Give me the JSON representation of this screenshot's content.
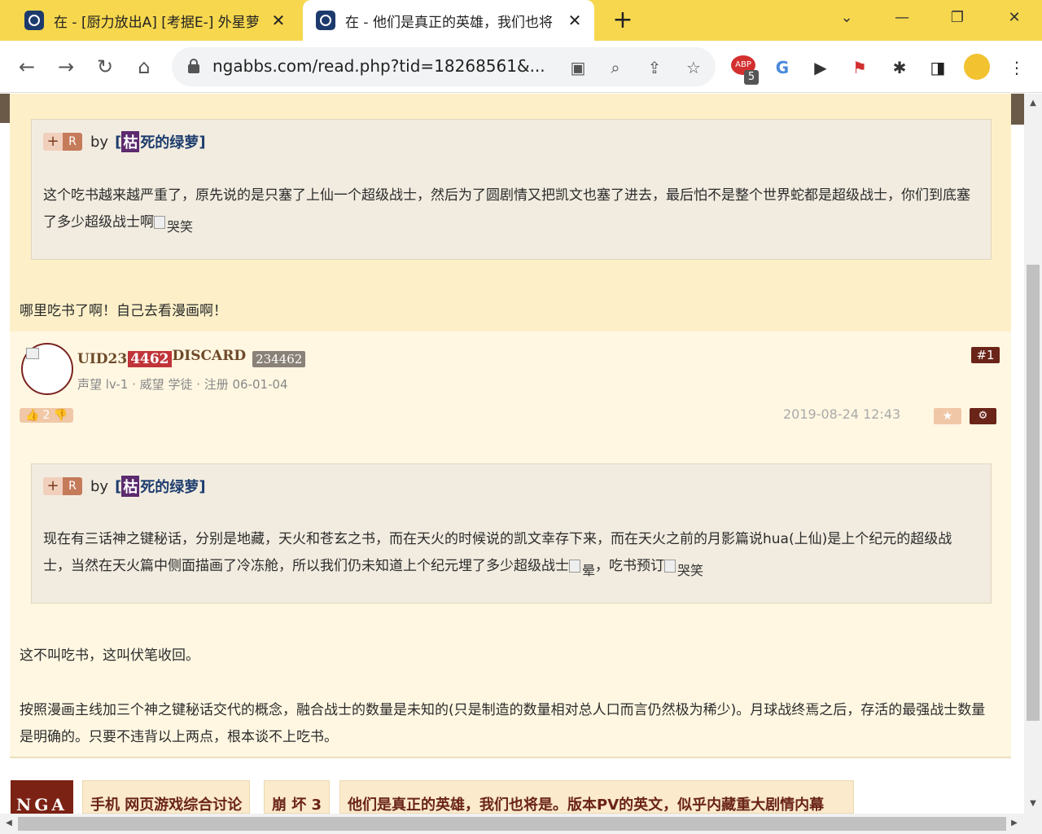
{
  "browser": {
    "tabs": [
      {
        "title": "在 - [厨力放出A] [考据E-] 外星萝",
        "active": false
      },
      {
        "title": "在 - 他们是真正的英雄，我们也将",
        "active": true
      }
    ],
    "new_tab": "+",
    "url": "ngabbs.com/read.php?tid=18268561&...",
    "extension_badge": "5",
    "accent_color": "#f6d74e"
  },
  "post0": {
    "quote": {
      "plus": "+",
      "r": "R",
      "by": "by",
      "bracket_open": "[",
      "name_char": "枯",
      "name_rest": "死的绿萝",
      "bracket_close": "]",
      "text": "这个吃书越来越严重了，原先说的是只塞了上仙一个超级战士，然后为了圆剧情又把凯文也塞了进去，最后怕不是整个世界蛇都是超级战士，你们到底塞了多少超级战士啊",
      "emoji": "哭笑"
    },
    "reply": "哪里吃书了啊！自己去看漫画啊！"
  },
  "post1": {
    "user": {
      "name_prefix": "UID23",
      "name_highlight": "4462",
      "name_suffix": "DISCARD",
      "uid_badge": "234462",
      "meta": "声望 lv-1 · 威望 学徒 · 注册 06-01-04"
    },
    "floor": "#1",
    "likes": "2",
    "timestamp": "2019-08-24 12:43",
    "quote": {
      "plus": "+",
      "r": "R",
      "by": "by",
      "bracket_open": "[",
      "name_char": "枯",
      "name_rest": "死的绿萝",
      "bracket_close": "]",
      "text_a": "现在有三话神之键秘话，分别是地藏，天火和苍玄之书，而在天火的时候说的凯文幸存下来，而在天火之前的月影篇说hua(上仙)是上个纪元的超级战士，当然在天火篇中侧面描画了冷冻舱，所以我们仍未知道上个纪元埋了多少超级战士",
      "emoji_a": "晕",
      "text_b": "，吃书预订",
      "emoji_b": "哭笑"
    },
    "para1": "这不叫吃书，这叫伏笔收回。",
    "para2": "按照漫画主线加三个神之键秘话交代的概念，融合战士的数量是未知的(只是制造的数量相对总人口而言仍然极为稀少)。月球战终焉之后，存活的最强战士数量是明确的。只要不违背以上两点，根本谈不上吃书。"
  },
  "bottom_nav": {
    "logo": "NGA",
    "crumbs": [
      "手机 网页游戏综合讨论",
      "崩 坏 3",
      "他们是真正的英雄，我们也将是。版本PV的英文，似乎内藏重大剧情内幕"
    ]
  }
}
